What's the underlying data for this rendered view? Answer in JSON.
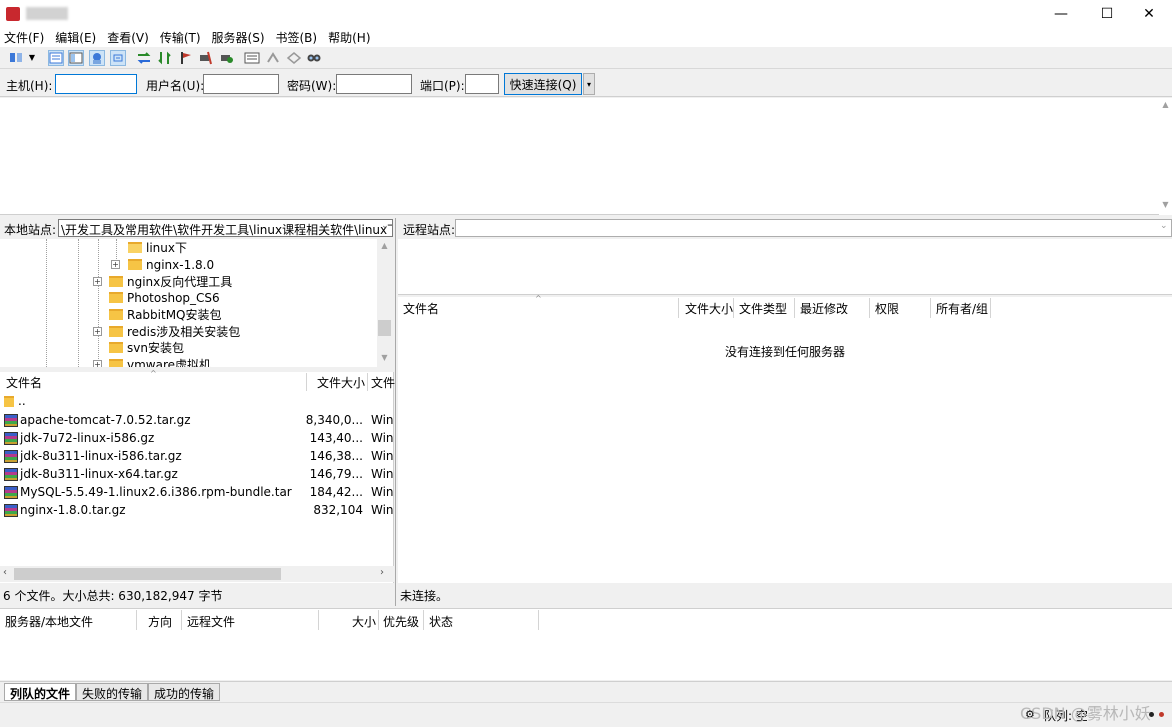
{
  "window": {
    "min_label": "—",
    "max_label": "☐",
    "close_label": "✕"
  },
  "menu": [
    "文件(F)",
    "编辑(E)",
    "查看(V)",
    "传输(T)",
    "服务器(S)",
    "书签(B)",
    "帮助(H)"
  ],
  "quickconnect": {
    "host_label": "主机(H):",
    "host_value": "",
    "user_label": "用户名(U):",
    "user_value": "",
    "pass_label": "密码(W):",
    "pass_value": "",
    "port_label": "端口(P):",
    "port_value": "",
    "button": "快速连接(Q)",
    "dropdown": "▾"
  },
  "local": {
    "site_label": "本地站点:",
    "site_path": "\\开发工具及常用软件\\软件开发工具\\linux课程相关软件\\linux下\\",
    "tree": [
      "linux下",
      "nginx-1.8.0",
      "nginx反向代理工具",
      "Photoshop_CS6",
      "RabbitMQ安装包",
      "redis涉及相关安装包",
      "svn安装包",
      "vmware虚拟机"
    ],
    "columns": {
      "name": "文件名",
      "size": "文件大小",
      "type": "文件"
    },
    "parent_dir": "..",
    "files": [
      {
        "name": "apache-tomcat-7.0.52.tar.gz",
        "size": "8,340,0...",
        "type": "Win"
      },
      {
        "name": "jdk-7u72-linux-i586.gz",
        "size": "143,40...",
        "type": "Win"
      },
      {
        "name": "jdk-8u311-linux-i586.tar.gz",
        "size": "146,38...",
        "type": "Win"
      },
      {
        "name": "jdk-8u311-linux-x64.tar.gz",
        "size": "146,79...",
        "type": "Win"
      },
      {
        "name": "MySQL-5.5.49-1.linux2.6.i386.rpm-bundle.tar",
        "size": "184,42...",
        "type": "Win"
      },
      {
        "name": "nginx-1.8.0.tar.gz",
        "size": "832,104",
        "type": "Win"
      }
    ],
    "status": "6 个文件。大小总共: 630,182,947 字节"
  },
  "remote": {
    "site_label": "远程站点:",
    "columns": {
      "name": "文件名",
      "size": "文件大小",
      "type": "文件类型",
      "modified": "最近修改",
      "perms": "权限",
      "owner": "所有者/组"
    },
    "empty_message": "没有连接到任何服务器",
    "status": "未连接。"
  },
  "queue": {
    "columns": {
      "server": "服务器/本地文件",
      "direction": "方向",
      "remote": "远程文件",
      "size": "大小",
      "priority": "优先级",
      "status": "状态"
    },
    "tabs": [
      "列队的文件",
      "失败的传输",
      "成功的传输"
    ],
    "queue_label": "队列: 空"
  },
  "watermark": "CSDN @雾林小妖",
  "colors": {
    "accent": "#0078d7",
    "folder": "#f6c445"
  }
}
